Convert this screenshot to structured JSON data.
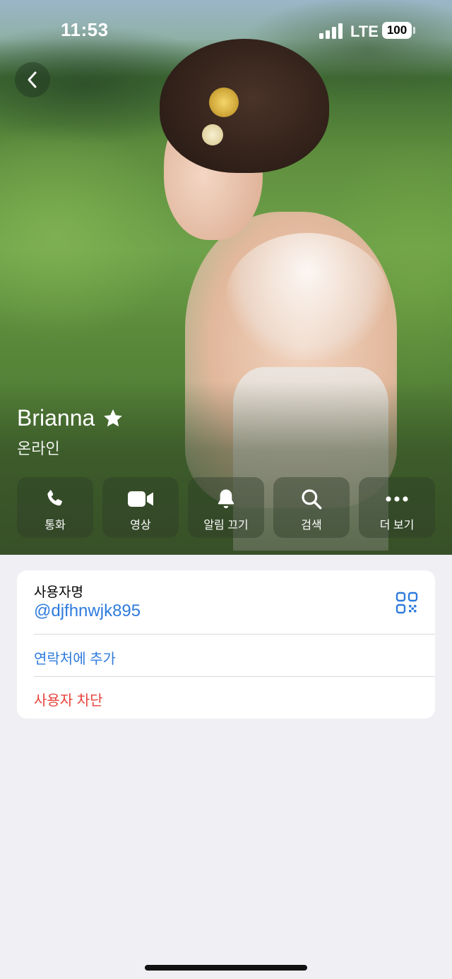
{
  "status_bar": {
    "time": "11:53",
    "network": "LTE",
    "battery": "100"
  },
  "profile": {
    "name": "Brianna",
    "status": "온라인",
    "photo_description": "woman in white lace dress with hair flower in green field"
  },
  "actions": [
    {
      "label": "통화",
      "icon": "phone-icon"
    },
    {
      "label": "영상",
      "icon": "video-icon"
    },
    {
      "label": "알림 끄기",
      "icon": "bell-icon"
    },
    {
      "label": "검색",
      "icon": "search-icon"
    },
    {
      "label": "더 보기",
      "icon": "more-icon"
    }
  ],
  "info": {
    "username_label": "사용자명",
    "username": "@djfhnwjk895",
    "add_contact": "연락처에 추가",
    "block_user": "사용자 차단"
  },
  "colors": {
    "link": "#2f7bdd",
    "destructive": "#e8413a",
    "background": "#efeff4"
  }
}
